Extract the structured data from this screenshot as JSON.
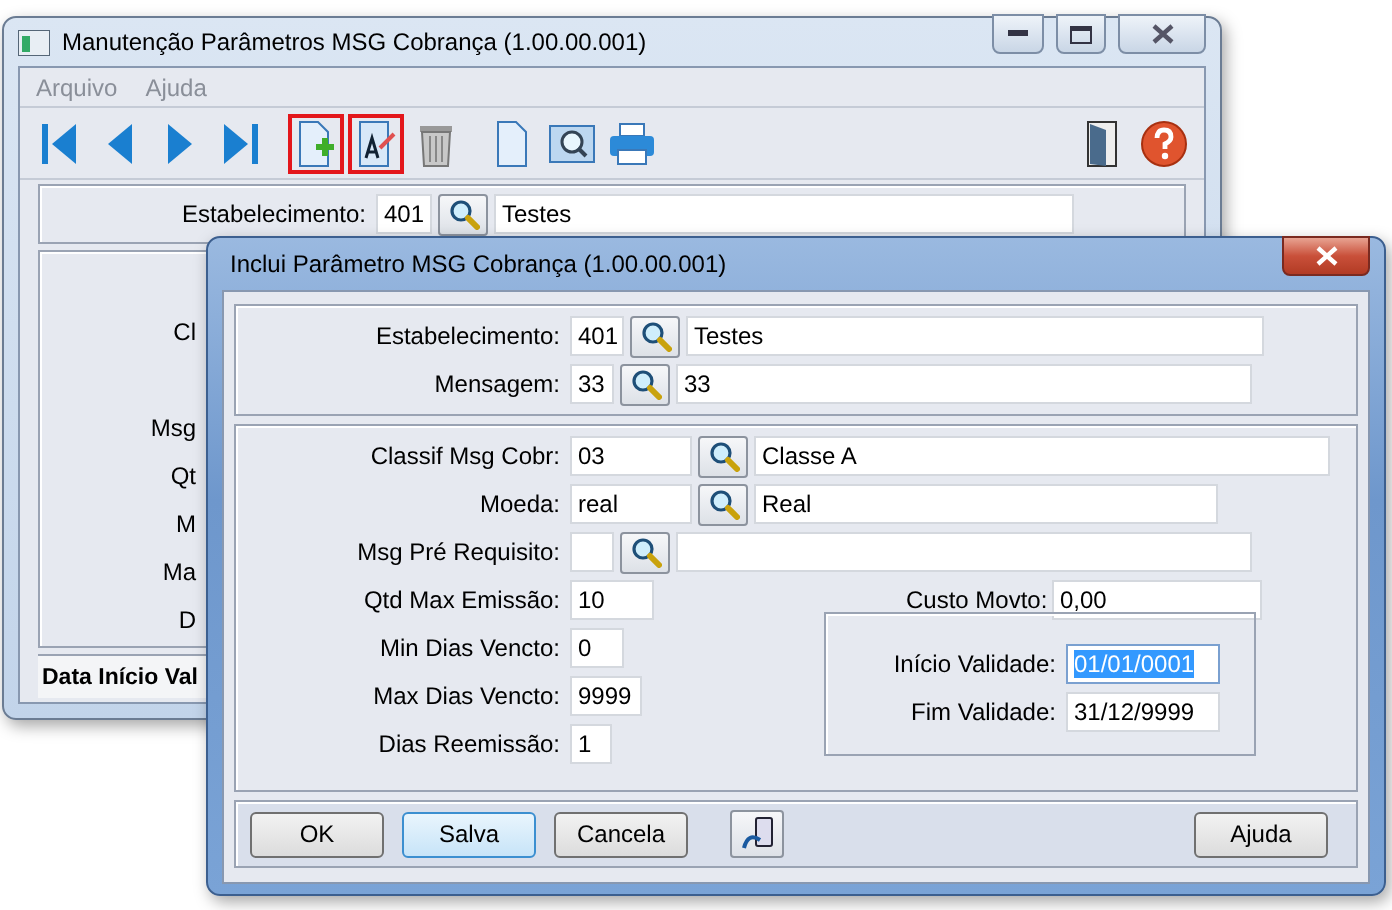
{
  "main_window": {
    "title": "Manutenção Parâmetros MSG Cobrança (1.00.00.001)",
    "active": false,
    "menu": [
      "Arquivo",
      "Ajuda"
    ],
    "toolbar": [
      {
        "kind": "first",
        "highlighted": false
      },
      {
        "kind": "prev",
        "highlighted": false
      },
      {
        "kind": "next",
        "highlighted": false
      },
      {
        "kind": "last",
        "highlighted": false
      },
      {
        "kind": "add",
        "highlighted": true
      },
      {
        "kind": "edit",
        "highlighted": true
      },
      {
        "kind": "delete",
        "highlighted": false
      },
      {
        "kind": "doc",
        "highlighted": false
      },
      {
        "kind": "preview",
        "highlighted": false
      },
      {
        "kind": "print",
        "highlighted": false
      }
    ],
    "estabelecimento": {
      "label": "Estabelecimento:",
      "code": "401",
      "name": "Testes"
    },
    "hidden_labels": [
      "Cl",
      "Msg",
      "Qt",
      "M",
      "Ma",
      "D"
    ],
    "tab_label": "Data Início Val"
  },
  "dialog": {
    "title": "Inclui Parâmetro MSG Cobrança (1.00.00.001)",
    "active": true,
    "estabelecimento": {
      "label": "Estabelecimento:",
      "code": "401",
      "name": "Testes"
    },
    "mensagem": {
      "label": "Mensagem:",
      "code": "33",
      "name": "33"
    },
    "classif": {
      "label": "Classif Msg Cobr:",
      "code": "03",
      "name": "Classe A"
    },
    "moeda": {
      "label": "Moeda:",
      "code": "real",
      "name": "Real"
    },
    "pre_requisito": {
      "label": "Msg Pré Requisito:"
    },
    "qtd_max": {
      "label": "Qtd Max Emissão:",
      "value": "10"
    },
    "custo": {
      "label": "Custo Movto:",
      "value": "0,00"
    },
    "min_dias": {
      "label": "Min Dias Vencto:",
      "value": "0"
    },
    "max_dias": {
      "label": "Max Dias Vencto:",
      "value": "9999"
    },
    "reemissao": {
      "label": "Dias Reemissão:",
      "value": "1"
    },
    "inicio": {
      "label": "Início Validade:",
      "value": "01/01/0001",
      "selected": true
    },
    "fim": {
      "label": "Fim Validade:",
      "value": "31/12/9999",
      "selected": false
    },
    "buttons": [
      {
        "label": "OK",
        "focused": false
      },
      {
        "label": "Salva",
        "focused": true
      },
      {
        "label": "Cancela",
        "focused": false
      }
    ],
    "help_button": "Ajuda"
  }
}
